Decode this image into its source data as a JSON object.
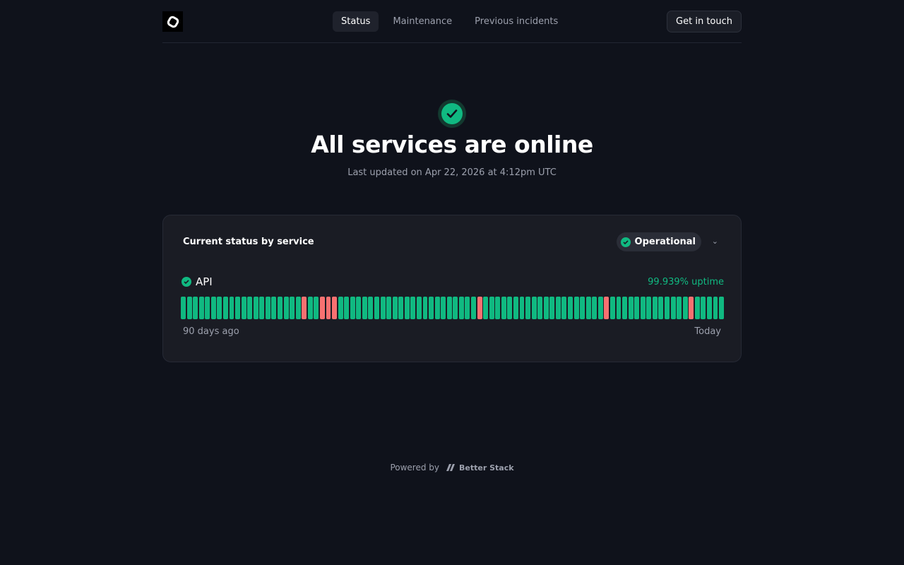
{
  "nav": {
    "items": [
      {
        "label": "Status",
        "active": true
      },
      {
        "label": "Maintenance"
      },
      {
        "label": "Previous incidents"
      }
    ],
    "cta": "Get in touch"
  },
  "hero": {
    "title": "All services are online",
    "updated": "Last updated on Apr 22, 2026 at 4:12pm UTC"
  },
  "card": {
    "title": "Current status by service",
    "status": "Operational",
    "service": {
      "name": "API",
      "uptime": "99.939% uptime",
      "days": 90,
      "incident_days": [
        20,
        23,
        24,
        25,
        49,
        70,
        84
      ]
    },
    "range_start": "90 days ago",
    "range_end": "Today"
  },
  "colors": {
    "up": "#10b981",
    "down": "#f87171"
  },
  "footer": {
    "powered": "Powered by",
    "brand": "Better Stack"
  }
}
